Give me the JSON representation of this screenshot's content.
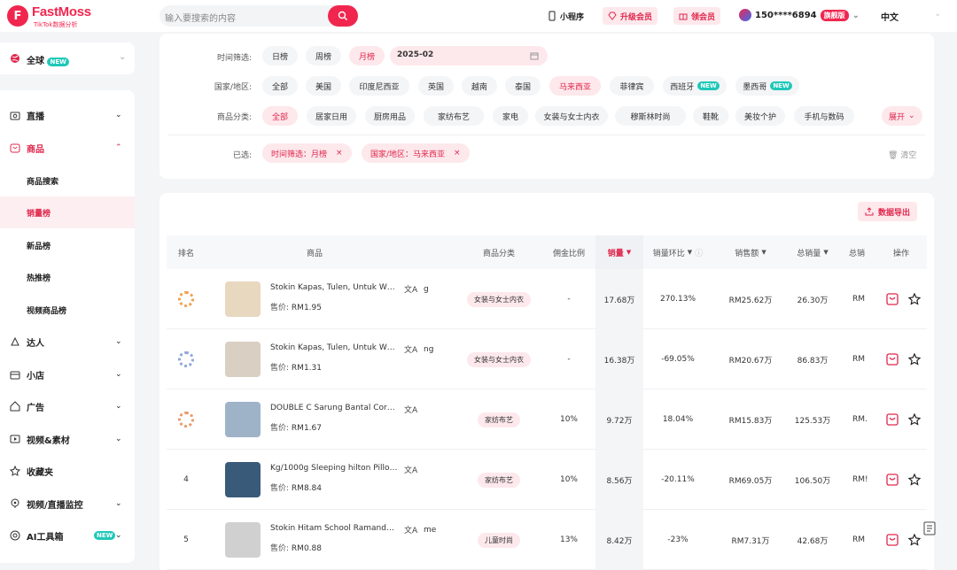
{
  "brand": {
    "name": "FastMoss",
    "sub": "TikTok数据分析",
    "accent": "#f0264f"
  },
  "search": {
    "placeholder": "输入要搜索的内容"
  },
  "topbar": {
    "mini_program": "小程序",
    "upgrade": "升级会员",
    "get_member": "领会员",
    "user_phone": "150****6894",
    "user_badge": "旗舰版",
    "language": "中文"
  },
  "sidebar": {
    "region": {
      "label": "全球",
      "badge": "NEW"
    },
    "items": [
      {
        "label": "直播",
        "icon": "live-icon",
        "chevron": "⌄"
      },
      {
        "label": "商品",
        "icon": "product-icon",
        "chevron": "⌃"
      },
      {
        "label": "商品搜索"
      },
      {
        "label": "销量榜"
      },
      {
        "label": "新品榜"
      },
      {
        "label": "热推榜"
      },
      {
        "label": "视频商品榜"
      },
      {
        "label": "达人",
        "icon": "creator-icon",
        "chevron": "⌄"
      },
      {
        "label": "小店",
        "icon": "shop-icon",
        "chevron": "⌄"
      },
      {
        "label": "广告",
        "icon": "ad-icon",
        "chevron": "⌄"
      },
      {
        "label": "视频&素材",
        "icon": "video-icon",
        "chevron": "⌄"
      },
      {
        "label": "收藏夹",
        "icon": "star-icon"
      },
      {
        "label": "视频/直播监控",
        "icon": "monitor-icon",
        "chevron": "⌄"
      },
      {
        "label": "AI工具箱",
        "icon": "ai-icon",
        "badge": "NEW",
        "chevron": "⌄"
      }
    ]
  },
  "filters": {
    "time_label": "时间筛选:",
    "time_options": [
      "日榜",
      "周榜",
      "月榜"
    ],
    "date_value": "2025-02",
    "region_label": "国家/地区:",
    "regions": [
      "全部",
      "美国",
      "印度尼西亚",
      "英国",
      "越南",
      "泰国",
      "马来西亚",
      "菲律宾",
      "西班牙",
      "墨西哥"
    ],
    "region_new_badge": "NEW",
    "category_label": "商品分类:",
    "categories": [
      "全部",
      "居家日用",
      "厨房用品",
      "家纺布艺",
      "家电",
      "女装与女士内衣",
      "穆斯林时尚",
      "鞋靴",
      "美妆个护",
      "手机与数码"
    ],
    "expand_label": "展开",
    "selected_label": "已选:",
    "selected": [
      "时间筛选：月榜",
      "国家/地区：马来西亚"
    ],
    "clear_label": "清空"
  },
  "table": {
    "export_label": "数据导出",
    "headers": [
      "排名",
      "商品",
      "商品分类",
      "佣金比例",
      "销量",
      "销量环比",
      "销售额",
      "总销量",
      "总销",
      "操作"
    ],
    "price_prefix": "售价:",
    "rows": [
      {
        "rank": "",
        "medal_color": "#f0a050",
        "name": "Stokin Kapas, Tulen, Untuk W…",
        "overflow": "g",
        "price": "RM1.95",
        "category": "女装与女士内衣",
        "commission": "-",
        "sales": "17.68万",
        "growth": "270.13%",
        "revenue": "RM25.62万",
        "total_sales": "26.30万",
        "total_rev": "RM",
        "thumb": "#e8d8c0"
      },
      {
        "rank": "",
        "medal_color": "#8fa6d8",
        "name": "Stokin Kapas, Tulen, Untuk W…",
        "overflow": "ng",
        "price": "RM1.31",
        "category": "女装与女士内衣",
        "commission": "-",
        "sales": "16.38万",
        "growth": "-69.05%",
        "revenue": "RM20.67万",
        "total_sales": "86.83万",
        "total_rev": "RM",
        "thumb": "#d9cfc2"
      },
      {
        "rank": "",
        "medal_color": "#e89a6a",
        "name": "DOUBLE C Sarung Bantal Cora…",
        "overflow": "",
        "price": "RM1.67",
        "category": "家纺布艺",
        "commission": "10%",
        "sales": "9.72万",
        "growth": "18.04%",
        "revenue": "RM15.83万",
        "total_sales": "125.53万",
        "total_rev": "RM.",
        "thumb": "#9fb3c8"
      },
      {
        "rank": "4",
        "medal_color": "",
        "name": "Kg/1000g Sleeping hilton Pillo…",
        "overflow": "",
        "price": "RM8.84",
        "category": "家纺布艺",
        "commission": "10%",
        "sales": "8.56万",
        "growth": "-20.11%",
        "revenue": "RM69.05万",
        "total_sales": "106.50万",
        "total_rev": "RM!",
        "thumb": "#3a5a7a"
      },
      {
        "rank": "5",
        "medal_color": "",
        "name": "Stokin Hitam School Ramand…",
        "overflow": "me",
        "price": "RM0.88",
        "category": "儿童时尚",
        "commission": "13%",
        "sales": "8.42万",
        "growth": "-23%",
        "revenue": "RM7.31万",
        "total_sales": "42.68万",
        "total_rev": "RM",
        "thumb": "#d0d0d0"
      }
    ]
  }
}
